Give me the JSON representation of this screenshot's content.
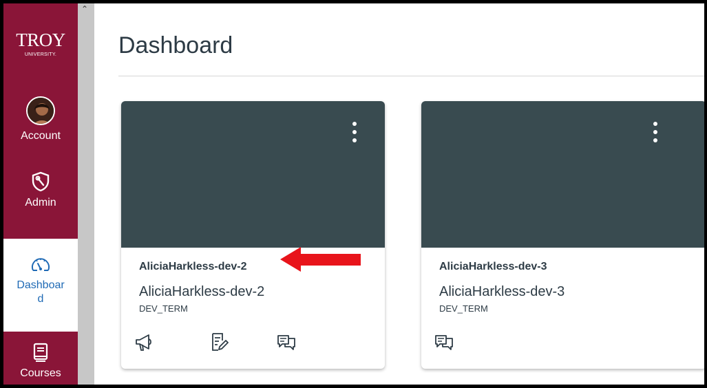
{
  "logo": {
    "main": "TROY",
    "sub": "UNIVERSITY."
  },
  "nav": [
    {
      "label": "Account",
      "icon": "avatar"
    },
    {
      "label": "Admin",
      "icon": "shield-wrench-icon"
    },
    {
      "label_line1": "Dashboar",
      "label_line2": "d",
      "icon": "speedometer-icon",
      "active": true
    },
    {
      "label": "Courses",
      "icon": "book-icon"
    }
  ],
  "header": {
    "title": "Dashboard"
  },
  "cards": [
    {
      "short_name": "AliciaHarkless-dev-2",
      "name": "AliciaHarkless-dev-2",
      "term": "DEV_TERM",
      "hero_color": "#394b50",
      "actions": [
        "announcements-icon",
        "assignments-icon",
        "discussions-icon"
      ]
    },
    {
      "short_name": "AliciaHarkless-dev-3",
      "name": "AliciaHarkless-dev-3",
      "term": "DEV_TERM",
      "hero_color": "#394b50",
      "actions": [
        "discussions-icon"
      ]
    }
  ],
  "colors": {
    "brand": "#8a1538",
    "link": "#1f6ab5",
    "annotation_arrow": "#e8141b"
  }
}
